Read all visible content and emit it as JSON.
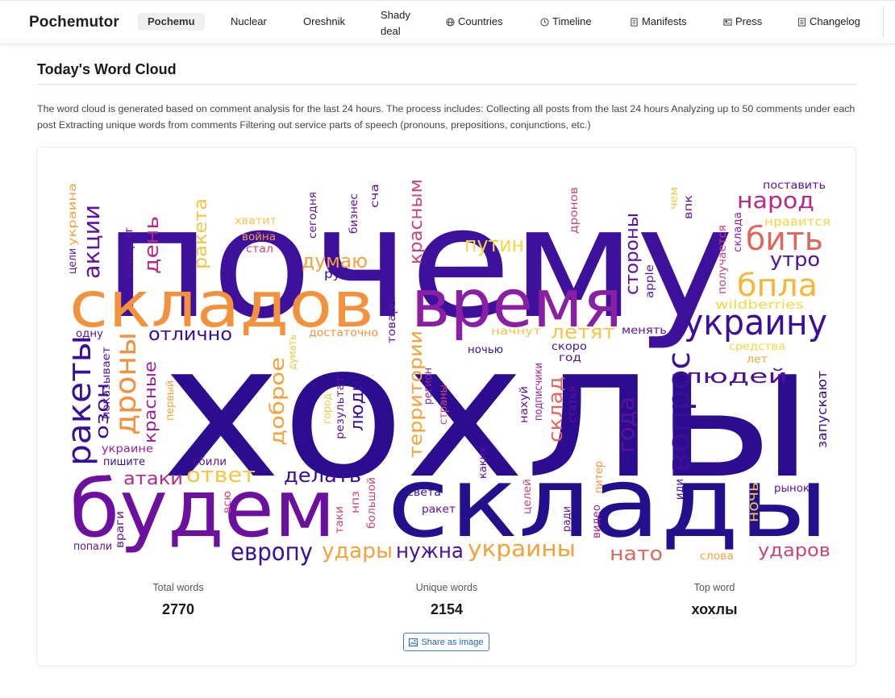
{
  "nav": {
    "brand": "Pochemutor",
    "items": [
      {
        "label": "Pochemu",
        "active": true,
        "icon": ""
      },
      {
        "label": "Nuclear",
        "icon": ""
      },
      {
        "label": "Oreshnik",
        "icon": ""
      },
      {
        "label_line1": "Shady",
        "label_line2": "deal",
        "icon": ""
      },
      {
        "label": "Countries",
        "icon": "globe-icon"
      },
      {
        "label": "Timeline",
        "icon": "clock-icon"
      },
      {
        "label": "Manifests",
        "icon": "document-icon"
      },
      {
        "label": "Press",
        "icon": "newspaper-icon"
      },
      {
        "label": "Changelog",
        "icon": "list-icon"
      }
    ]
  },
  "page": {
    "title": "Today's Word Cloud",
    "description": "The word cloud is generated based on comment analysis for the last 24 hours. The process includes: Collecting all posts from the last 24 hours Analyzing up to 50 comments under each post Extracting unique words from comments Filtering out service parts of speech (pronouns, prepositions, conjunctions, etc.)"
  },
  "stats": {
    "total_label": "Total words",
    "total_value": "2770",
    "unique_label": "Unique words",
    "unique_value": "2154",
    "top_label": "Top word",
    "top_value": "хохлы"
  },
  "share_button": {
    "label": "Share as image",
    "icon": "image-icon"
  },
  "colors": {
    "accent": "#2468c2",
    "cloud_dark": "#2a0f8a",
    "cloud_mid": "#7a14a0",
    "cloud_orange": "#f49a3c",
    "cloud_yellow": "#f5d742"
  },
  "word_cloud": {
    "words": [
      {
        "text": "почему",
        "color": "#3e119c"
      },
      {
        "text": "хохлы",
        "color": "#2c0d8f"
      },
      {
        "text": "складов",
        "color": "#f4913d"
      },
      {
        "text": "время",
        "color": "#8a1fa3"
      },
      {
        "text": "склады",
        "color": "#23108c"
      },
      {
        "text": "будем",
        "color": "#6c10a0"
      },
      {
        "text": "украину",
        "color": "#3b0f99"
      },
      {
        "text": "народ",
        "color": "#b52a86"
      },
      {
        "text": "бить",
        "color": "#e0665c"
      },
      {
        "text": "бпла",
        "color": "#f7b53a"
      },
      {
        "text": "утро",
        "color": "#4a1299"
      },
      {
        "text": "вопрос",
        "color": "#3a0f97"
      },
      {
        "text": "людей",
        "color": "#4a1299"
      },
      {
        "text": "года",
        "color": "#5b12a0"
      },
      {
        "text": "ракеты",
        "color": "#3a0f97"
      },
      {
        "text": "дроны",
        "color": "#f4913d"
      },
      {
        "text": "акции",
        "color": "#5b12a0"
      },
      {
        "text": "день",
        "color": "#b52a86"
      },
      {
        "text": "ракета",
        "color": "#f5c546"
      },
      {
        "text": "путин",
        "color": "#f5d742"
      },
      {
        "text": "думаю",
        "color": "#f4a23c"
      },
      {
        "text": "красным",
        "color": "#c8447a"
      },
      {
        "text": "отлично",
        "color": "#3a0f97"
      },
      {
        "text": "летят",
        "color": "#f5c546"
      },
      {
        "text": "стороны",
        "color": "#5b12a0"
      },
      {
        "text": "территории",
        "color": "#f4a23c"
      },
      {
        "text": "доброе",
        "color": "#f4a23c"
      },
      {
        "text": "люди",
        "color": "#3a0f97"
      },
      {
        "text": "склад",
        "color": "#e0665c"
      },
      {
        "text": "красные",
        "color": "#9a1f9b"
      },
      {
        "text": "озон",
        "color": "#3a0f97"
      },
      {
        "text": "атаки",
        "color": "#b52a86"
      },
      {
        "text": "ответ",
        "color": "#f5c546"
      },
      {
        "text": "делать",
        "color": "#3a0f97"
      },
      {
        "text": "европу",
        "color": "#3a0f97"
      },
      {
        "text": "удары",
        "color": "#f4a23c"
      },
      {
        "text": "нужна",
        "color": "#4a1299"
      },
      {
        "text": "украины",
        "color": "#f4a23c"
      },
      {
        "text": "нато",
        "color": "#e0665c"
      },
      {
        "text": "ударов",
        "color": "#c8447a"
      },
      {
        "text": "ночь",
        "color": "#f5c546"
      },
      {
        "text": "запускают",
        "color": "#3a0f97"
      },
      {
        "text": "русских",
        "color": "#3a0f97"
      },
      {
        "text": "wildberries",
        "color": "#f5d742"
      },
      {
        "text": "нравится",
        "color": "#f5d742"
      },
      {
        "text": "поставить",
        "color": "#5b12a0"
      },
      {
        "text": "средства",
        "color": "#f5d742"
      },
      {
        "text": "начнут",
        "color": "#f5c546"
      },
      {
        "text": "менять",
        "color": "#5b12a0"
      },
      {
        "text": "достаточно",
        "color": "#f4913d"
      },
      {
        "text": "скоро",
        "color": "#4a1299"
      },
      {
        "text": "год",
        "color": "#4a1299"
      },
      {
        "text": "ночью",
        "color": "#3a0f97"
      },
      {
        "text": "лет",
        "color": "#f4a23c"
      },
      {
        "text": "хватит",
        "color": "#f5c546"
      },
      {
        "text": "война",
        "color": "#f4a23c"
      },
      {
        "text": "стал",
        "color": "#c8447a"
      },
      {
        "text": "сегодня",
        "color": "#5b12a0"
      },
      {
        "text": "бизнес",
        "color": "#5b12a0"
      },
      {
        "text": "сча",
        "color": "#4a1299"
      },
      {
        "text": "товары",
        "color": "#5b12a0"
      },
      {
        "text": "думать",
        "color": "#f5c546"
      },
      {
        "text": "регион",
        "color": "#9a1f9b"
      },
      {
        "text": "страны",
        "color": "#c8447a"
      },
      {
        "text": "результат",
        "color": "#5b12a0"
      },
      {
        "text": "город",
        "color": "#f5c546"
      },
      {
        "text": "первый",
        "color": "#f4a23c"
      },
      {
        "text": "показывает",
        "color": "#5b12a0"
      },
      {
        "text": "одну",
        "color": "#5b12a0"
      },
      {
        "text": "цели",
        "color": "#5b12a0"
      },
      {
        "text": "украина",
        "color": "#f4a23c"
      },
      {
        "text": "говорят",
        "color": "#5b12a0"
      },
      {
        "text": "украине",
        "color": "#9a1f9b"
      },
      {
        "text": "пишите",
        "color": "#3a0f97"
      },
      {
        "text": "сбили",
        "color": "#5b12a0"
      },
      {
        "text": "всю",
        "color": "#c8447a"
      },
      {
        "text": "враги",
        "color": "#5b12a0"
      },
      {
        "text": "попали",
        "color": "#5b12a0"
      },
      {
        "text": "нпз",
        "color": "#c8447a"
      },
      {
        "text": "таки",
        "color": "#c8447a"
      },
      {
        "text": "большой",
        "color": "#c8447a"
      },
      {
        "text": "света",
        "color": "#3a0f97"
      },
      {
        "text": "ракет",
        "color": "#5b12a0"
      },
      {
        "text": "каких",
        "color": "#5b12a0"
      },
      {
        "text": "целей",
        "color": "#c8447a"
      },
      {
        "text": "ради",
        "color": "#5b12a0"
      },
      {
        "text": "видео",
        "color": "#9a1f9b"
      },
      {
        "text": "питер",
        "color": "#f4913d"
      },
      {
        "text": "иди",
        "color": "#3a0f97"
      },
      {
        "text": "слова",
        "color": "#f4a23c"
      },
      {
        "text": "рынок",
        "color": "#5b12a0"
      },
      {
        "text": "нахуй",
        "color": "#5b12a0"
      },
      {
        "text": "подписчики",
        "color": "#9a1f9b"
      },
      {
        "text": "статья",
        "color": "#5b12a0"
      },
      {
        "text": "дронов",
        "color": "#c8447a"
      },
      {
        "text": "apple",
        "color": "#5b12a0"
      },
      {
        "text": "чем",
        "color": "#f5c546"
      },
      {
        "text": "впк",
        "color": "#5b12a0"
      },
      {
        "text": "склада",
        "color": "#9a1f9b"
      },
      {
        "text": "получается",
        "color": "#c8447a"
      }
    ]
  }
}
